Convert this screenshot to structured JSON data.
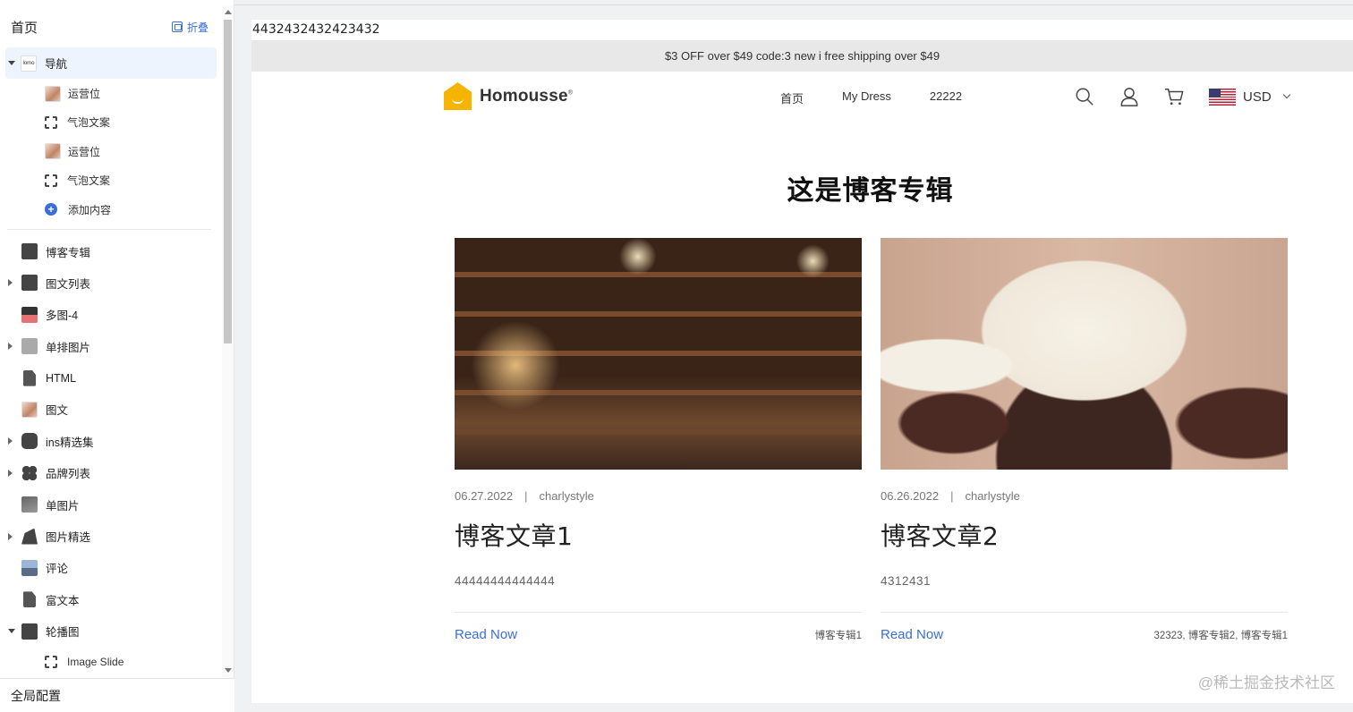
{
  "sidebar": {
    "title": "首页",
    "collapse_label": "折叠",
    "items": [
      {
        "label": "导航",
        "caret": "down",
        "icon": "logo-thumb-icon",
        "icon_text": "lomo",
        "active": true
      },
      {
        "label": "运营位",
        "child": true,
        "icon": "image-thumb-icon"
      },
      {
        "label": "气泡文案",
        "child": true,
        "icon": "frame-icon"
      },
      {
        "label": "运营位",
        "child": true,
        "icon": "image-thumb-icon"
      },
      {
        "label": "气泡文案",
        "child": true,
        "icon": "frame-icon"
      },
      {
        "label": "添加内容",
        "child": true,
        "icon": "plus-circle-icon",
        "add": true
      },
      {
        "label": "博客专辑",
        "icon": "star-icon"
      },
      {
        "label": "图文列表",
        "caret": "right",
        "icon": "image-list-icon"
      },
      {
        "label": "多图-4",
        "icon": "multi-image-icon"
      },
      {
        "label": "单排图片",
        "caret": "right",
        "icon": "grey-image-icon"
      },
      {
        "label": "HTML",
        "icon": "document-icon"
      },
      {
        "label": "图文",
        "icon": "image-thumb-icon"
      },
      {
        "label": "ins精选集",
        "caret": "right",
        "icon": "instagram-icon"
      },
      {
        "label": "品牌列表",
        "caret": "right",
        "icon": "grid-icon"
      },
      {
        "label": "单图片",
        "icon": "photo-icon"
      },
      {
        "label": "图片精选",
        "caret": "right",
        "icon": "bag-icon"
      },
      {
        "label": "评论",
        "icon": "city-photo-icon"
      },
      {
        "label": "富文本",
        "icon": "document-icon"
      },
      {
        "label": "轮播图",
        "caret": "down",
        "icon": "carousel-icon"
      },
      {
        "label": "Image Slide",
        "child": true,
        "icon": "frame-icon"
      }
    ],
    "footer_label": "全局配置"
  },
  "preview": {
    "url_text": "4432432432423432",
    "promo_text": "$3 OFF over $49 code:3 new i free shipping over $49",
    "logo_text": "Homousse",
    "logo_mark": "®",
    "nav_links": [
      "首页",
      "My Dress",
      "22222"
    ],
    "currency": "USD",
    "blog_title": "这是博客专辑",
    "posts": [
      {
        "date": "06.27.2022",
        "author": "charlystyle",
        "title": "博客文章1",
        "excerpt": "44444444444444",
        "read_label": "Read Now",
        "tags": "博客专辑1"
      },
      {
        "date": "06.26.2022",
        "author": "charlystyle",
        "title": "博客文章2",
        "excerpt": "4312431",
        "read_label": "Read Now",
        "tags": "32323, 博客专辑2, 博客专辑1"
      }
    ],
    "meta_separator": "|"
  },
  "watermark": "@稀土掘金技术社区",
  "colors": {
    "accent": "#3a6fd8",
    "logo": "#f4b400",
    "promo_bg": "#e8e8e8"
  }
}
